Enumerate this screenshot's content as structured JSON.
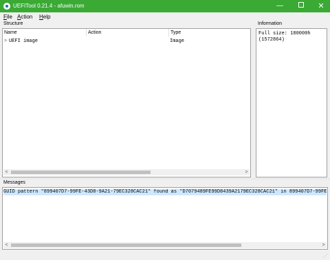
{
  "window": {
    "title": "UEFITool 0.21.4 - afuwin.rom",
    "minimize_glyph": "—",
    "close_glyph": "✕",
    "titlebar_color": "#3aaa35"
  },
  "menu": [
    {
      "label": "File",
      "accel": "F",
      "rest": "ile"
    },
    {
      "label": "Action",
      "accel": "A",
      "rest": "ction"
    },
    {
      "label": "Help",
      "accel": "H",
      "rest": "elp"
    }
  ],
  "structure": {
    "group_label": "Structure",
    "columns": [
      "Name",
      "Action",
      "Type"
    ],
    "rows": [
      {
        "expander": ">",
        "name": "UEFI image",
        "action": "",
        "type": "Image"
      }
    ],
    "scroll_left": "<",
    "scroll_right": ">"
  },
  "information": {
    "group_label": "Information",
    "text": "Full size: 180000h\n(1572864)"
  },
  "messages": {
    "group_label": "Messages",
    "rows": [
      "GUID pattern \"899407D7-99FE-43D8-9A21-79EC328CAC21\" found as \"D7079489FE99D8439A2179EC328CAC21\" in 899407D7-99FE"
    ],
    "scroll_left": "<",
    "scroll_right": ">"
  }
}
